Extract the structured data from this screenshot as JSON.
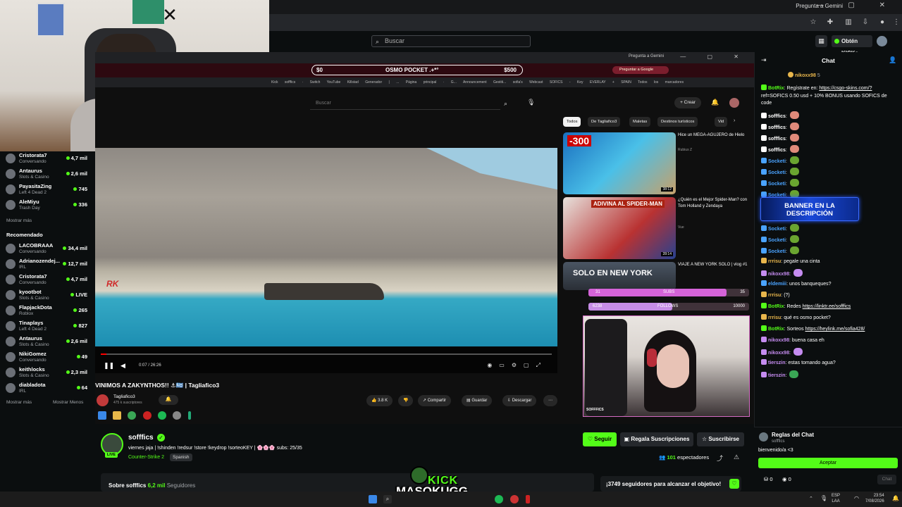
{
  "browser": {
    "gemini_label": "Pregunta a Gemini",
    "window_controls": "— ▢ ✕"
  },
  "header": {
    "search_placeholder": "Buscar",
    "get_kicks": "Obtén KICKs"
  },
  "sidebar": {
    "following": [
      {
        "name": "Cristorata7",
        "category": "Conversando",
        "viewers": "4,7 mil"
      },
      {
        "name": "Antaurus",
        "category": "Slots & Casino",
        "viewers": "2,6 mil"
      },
      {
        "name": "PayasitaZing",
        "category": "Left 4 Dead 2",
        "viewers": "745"
      },
      {
        "name": "AleMiyu",
        "category": "Trash Day",
        "viewers": "336"
      }
    ],
    "show_more_1": "Mostrar más",
    "recommended_heading": "Recomendado",
    "recommended": [
      {
        "name": "LACOBRAAA",
        "category": "Conversando",
        "viewers": "34,4 mil"
      },
      {
        "name": "Adrianozendej...",
        "category": "IRL",
        "viewers": "12,7 mil"
      },
      {
        "name": "Cristorata7",
        "category": "Conversando",
        "viewers": "4,7 mil"
      },
      {
        "name": "kyootbot",
        "category": "Slots & Casino",
        "viewers": "LIVE"
      },
      {
        "name": "FlapjackDota",
        "category": "Roblox",
        "viewers": "265"
      },
      {
        "name": "Tinaplays",
        "category": "Left 4 Dead 2",
        "viewers": "827"
      },
      {
        "name": "Antaurus",
        "category": "Slots & Casino",
        "viewers": "2,6 mil"
      },
      {
        "name": "NikiGomez",
        "category": "Conversando",
        "viewers": "49"
      },
      {
        "name": "keithlocks",
        "category": "Slots & Casino",
        "viewers": "2,3 mil"
      },
      {
        "name": "diabladota",
        "category": "IRL",
        "viewers": "64"
      }
    ],
    "show_more_2": "Mostrar más",
    "show_less": "Mostrar Menos"
  },
  "capture": {
    "gemini_label": "Pregunta a Gemini",
    "banner_left": "$0",
    "banner_center": "OSMO POCKET .+*°",
    "banner_right": "$500",
    "google_btn": "Preguntar a Google",
    "bookmarks": "Kick sofffics · Switch YouTube Killstad Generador | ... Página principal · G... Announcement Gestiti... sofia's Webcast SOFICS - Key EVERLAY + SPAIN Todos los marcadores",
    "yt_search": "Buscar",
    "create_btn": "+ Crear",
    "chips": [
      "Todos",
      "De Tagliafico3",
      "Maletas",
      "Destinos turísticos",
      "Vid"
    ],
    "related": [
      {
        "title": "Hice un MEGA-AGUJERO de Hielo",
        "channel": "Rubius Z",
        "duration": "38:12"
      },
      {
        "title": "¿Quién es el Mejor Spider-Man? con Tom Holland y Zendaya",
        "channel": "Vue",
        "duration": "28:14"
      },
      {
        "title": "VIAJE A NEW YORK SOLO | vlog #1",
        "channel": "",
        "duration": ""
      }
    ],
    "thumb_text_1": "-300",
    "thumb_text_2": "ADIVINA AL SPIDER-MAN",
    "thumb_text_3": "SOLO EN NEW YORK",
    "subs_label": "SUBS",
    "subs_left": "31",
    "subs_right": "35",
    "follows_label": "FOLLOWS",
    "follows_left": "6238",
    "follows_right": "10000",
    "subs_fraction": 0.86,
    "follows_fraction": 0.52,
    "video_watermark": "RK",
    "video_time": "0:07 / 26:26",
    "video_title": "VINIMOS A ZAKYNTHOS!! ⚓🇬🇷 | Tagliafico3",
    "video_channel": "Tagliafico3",
    "video_subs": "475 k suscriptores",
    "likes": "3.8 K",
    "share": "Compartir",
    "save": "Guardar",
    "download": "Descargar",
    "webcam_tag": "SOFFFICS"
  },
  "stream": {
    "channel": "sofffics",
    "live": "LIVE",
    "title": "viernes jaja | !shinden !redsur !store !keydrop !sorteoKEY | 🌸🌸🌸 subs: 25/35",
    "category": "Counter-Strike 2",
    "language": "Spanish",
    "follow": "Seguir",
    "gift": "Regala Suscripciones",
    "subscribe": "Suscribirse",
    "viewers": "101",
    "viewers_label": "espectadores",
    "about_prefix": "Sobre sofffics",
    "followers": "6,2 mil",
    "followers_label": "Seguidores",
    "goal": "¡3749 seguidores para alcanzar el objetivo!",
    "logo_top": "KICK",
    "logo_bottom": "MASOKUGG"
  },
  "chat": {
    "title": "Chat",
    "pinned_user": "nikoxx98",
    "pinned_count": "5",
    "messages": [
      {
        "user": "BotRix",
        "color": "#53fc18",
        "text": "Regístrate en: ",
        "link": "https://csgo-skins.com/?"
      },
      {
        "user": "",
        "color": "#ffffff",
        "text": "ref=SOFICS 0.50 usd + 10% BONUS usando SOFICS de",
        "link": ""
      },
      {
        "user": "",
        "color": "#ffffff",
        "text": "code",
        "link": ""
      },
      {
        "user": "sofffics",
        "color": "#ffffff",
        "text": "",
        "link": ""
      },
      {
        "user": "sofffics",
        "color": "#ffffff",
        "text": "",
        "link": ""
      },
      {
        "user": "sofffics",
        "color": "#ffffff",
        "text": "",
        "link": ""
      },
      {
        "user": "sofffics",
        "color": "#ffffff",
        "text": "",
        "link": ""
      },
      {
        "user": "Socketi",
        "color": "#4aa3ff",
        "text": "",
        "link": ""
      },
      {
        "user": "Socketi",
        "color": "#4aa3ff",
        "text": "",
        "link": ""
      },
      {
        "user": "Socketi",
        "color": "#4aa3ff",
        "text": "",
        "link": ""
      },
      {
        "user": "Socketi",
        "color": "#4aa3ff",
        "text": "",
        "link": ""
      },
      {
        "user": "Socketi",
        "color": "#4aa3ff",
        "text": "",
        "link": ""
      },
      {
        "user": "Socketi",
        "color": "#4aa3ff",
        "text": "",
        "link": ""
      },
      {
        "user": "Socketi",
        "color": "#4aa3ff",
        "text": "",
        "link": ""
      },
      {
        "user": "rrrisu",
        "color": "#e8b64c",
        "text": "pegale una cinta",
        "link": ""
      },
      {
        "user": "nikoxx98",
        "color": "#c58cf0",
        "text": "",
        "link": ""
      },
      {
        "user": "eldemiii",
        "color": "#4aa3ff",
        "text": "unos banqueques?",
        "link": ""
      },
      {
        "user": "rrrisu",
        "color": "#e8b64c",
        "text": "(?)",
        "link": ""
      },
      {
        "user": "BotRix",
        "color": "#53fc18",
        "text": "Redes ",
        "link": "https://linktr.ee/sofffics"
      },
      {
        "user": "rrrisu",
        "color": "#e8b64c",
        "text": "qué es osmo pocket?",
        "link": ""
      },
      {
        "user": "BotRix",
        "color": "#53fc18",
        "text": "Sorteos ",
        "link": "https://heylink.me/sofia428/"
      },
      {
        "user": "nikoxx98",
        "color": "#c58cf0",
        "text": "buena casa eh",
        "link": ""
      },
      {
        "user": "nikoxx98",
        "color": "#c58cf0",
        "text": "",
        "link": ""
      },
      {
        "user": "tierszin",
        "color": "#c58cf0",
        "text": "estas tomando agua?",
        "link": ""
      },
      {
        "user": "tierszin",
        "color": "#c58cf0",
        "text": "",
        "link": ""
      }
    ],
    "banner": "BANNER EN LA DESCRIPCIÓN",
    "rules_title": "Reglas del Chat",
    "rules_channel": "sofffics",
    "rules_text": "bienvenido/a <3",
    "accept": "Aceptar",
    "kicks": "0",
    "points": "0",
    "chat_btn": "Chat"
  },
  "taskbar": {
    "lang": "ESP",
    "region": "LAA",
    "time": "23:54",
    "date": "7/08/2026"
  }
}
